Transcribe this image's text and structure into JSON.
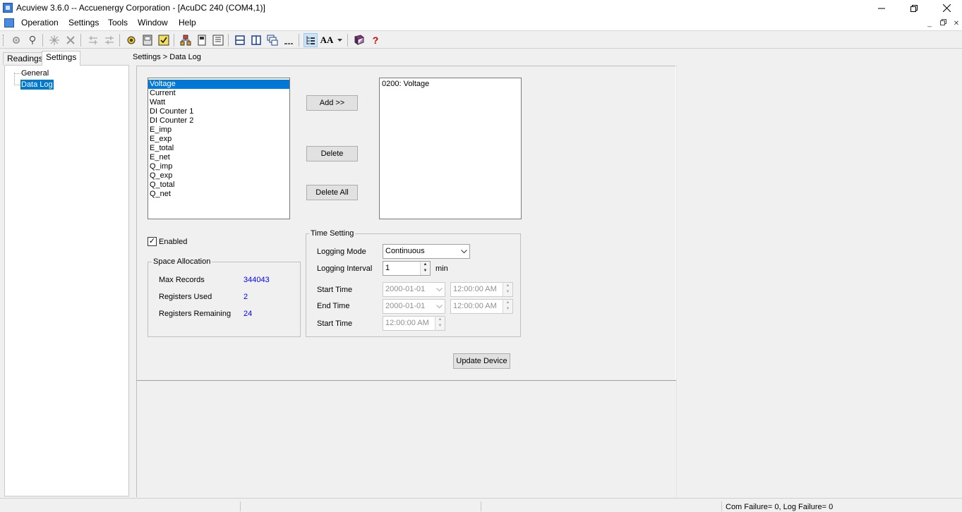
{
  "window": {
    "title": "Acuview 3.6.0 -- Accuenergy Corporation - [AcuDC 240 (COM4,1)]",
    "minimize": "—",
    "restore": "❐",
    "close": "✕"
  },
  "menu": {
    "items": [
      "Operation",
      "Settings",
      "Tools",
      "Window",
      "Help"
    ],
    "mdi_minimize": "_",
    "mdi_restore": "🗗",
    "mdi_close": "✕"
  },
  "toolbar": {
    "icons": [
      "gear-icon",
      "bulb-icon",
      "sparkle-icon",
      "disconnect-icon",
      "sliders-icon",
      "sliders-alt-icon",
      "settings-gear-icon",
      "device-icon",
      "checklist-icon",
      "network-icon",
      "meter-icon",
      "panel-icon",
      "tile-horizontal-icon",
      "tile-vertical-icon",
      "cascade-icon",
      "minimize-all-icon",
      "tree-view-icon",
      "font-size-icon",
      "dropdown-icon",
      "book-icon",
      "help-icon"
    ],
    "font_label": "AA",
    "help_label": "?"
  },
  "left_pane": {
    "tabs": [
      "Readings",
      "Settings"
    ],
    "selected_tab": "Settings",
    "tree": [
      {
        "label": "General",
        "selected": false
      },
      {
        "label": "Data Log",
        "selected": true
      }
    ]
  },
  "breadcrumb": "Settings > Data Log",
  "available_list": {
    "items": [
      "Voltage",
      "Current",
      "Watt",
      "DI Counter 1",
      "DI Counter 2",
      "E_imp",
      "E_exp",
      "E_total",
      "E_net",
      "Q_imp",
      "Q_exp",
      "Q_total",
      "Q_net"
    ],
    "selected": "Voltage"
  },
  "buttons": {
    "add": "Add >>",
    "delete": "Delete",
    "delete_all": "Delete All",
    "update_device": "Update Device"
  },
  "selected_list": {
    "items": [
      "0200: Voltage"
    ]
  },
  "enabled": {
    "label": "Enabled",
    "checked": true,
    "check_mark": "✓"
  },
  "space_allocation": {
    "title": "Space Allocation",
    "rows": [
      {
        "label": "Max Records",
        "value": "344043"
      },
      {
        "label": "Registers Used",
        "value": "2"
      },
      {
        "label": "Registers Remaining",
        "value": "24"
      }
    ]
  },
  "time_setting": {
    "title": "Time Setting",
    "logging_mode_label": "Logging Mode",
    "logging_mode_value": "Continuous",
    "logging_interval_label": "Logging Interval",
    "logging_interval_value": "1",
    "logging_interval_unit": "min",
    "start_time_label": "Start Time",
    "start_date": "2000-01-01",
    "start_time": "12:00:00 AM",
    "end_time_label": "End Time",
    "end_date": "2000-01-01",
    "end_time": "12:00:00 AM",
    "start_time2_label": "Start Time",
    "start_time2": "12:00:00 AM"
  },
  "status_bar": {
    "text": "Com Failure= 0, Log Failure= 0"
  }
}
